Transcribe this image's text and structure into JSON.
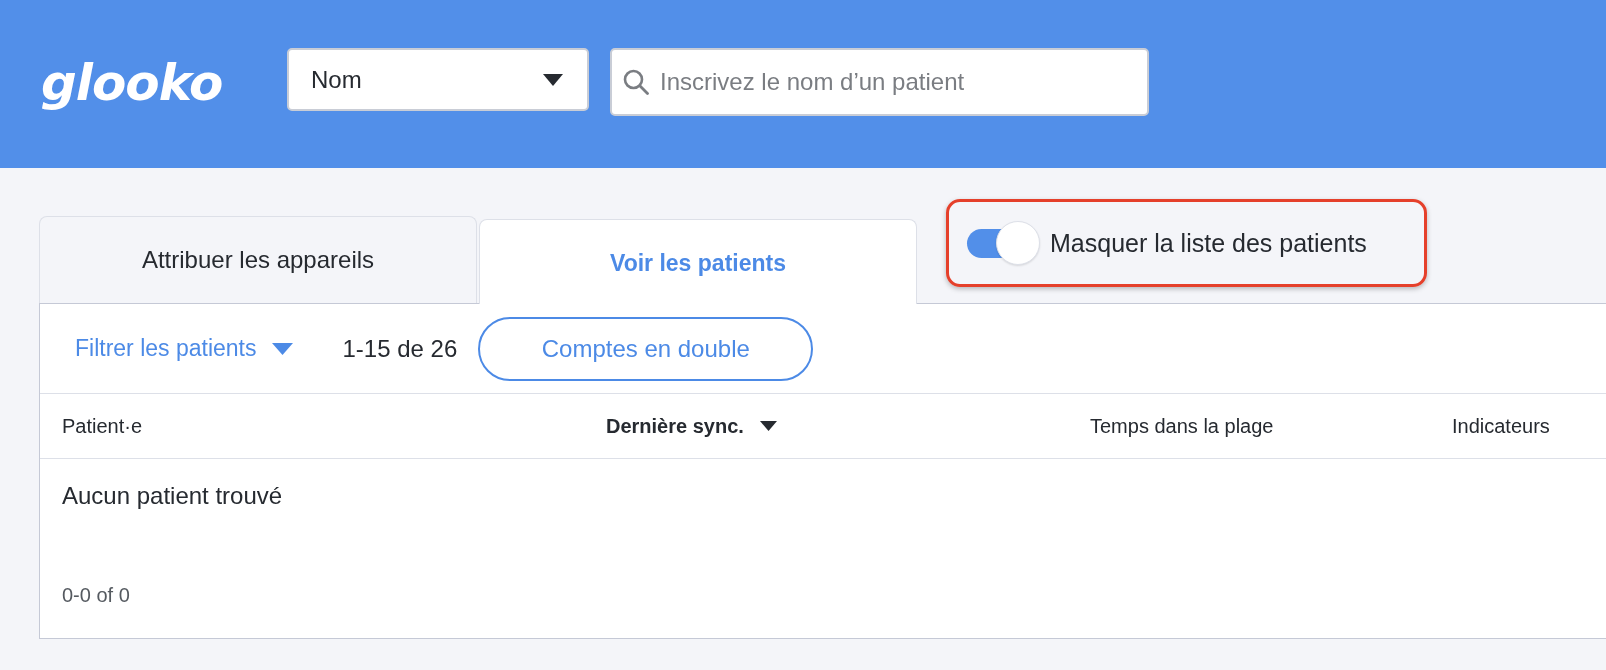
{
  "header": {
    "logo": "glooko",
    "search_by": {
      "value": "Nom"
    },
    "search": {
      "placeholder": "Inscrivez le nom d’un patient"
    }
  },
  "tabs": [
    {
      "label": "Attribuer les appareils",
      "selected": false
    },
    {
      "label": "Voir les patients",
      "selected": true
    }
  ],
  "hide_list_toggle": {
    "label": "Masquer la liste des patients",
    "on": true,
    "highlighted": true
  },
  "toolbar": {
    "filter": {
      "label": "Filtrer les patients"
    },
    "count": "1-15 de 26",
    "duplicates_button": "Comptes en double"
  },
  "table": {
    "columns": [
      {
        "label": "Patient·e",
        "sorted": false
      },
      {
        "label": "Dernière sync.",
        "sorted": true
      },
      {
        "label": "Temps dans la plage",
        "sorted": false
      },
      {
        "label": "Indicateurs",
        "sorted": false
      }
    ],
    "empty_message": "Aucun patient trouvé",
    "pagination": "0-0 of 0"
  }
}
